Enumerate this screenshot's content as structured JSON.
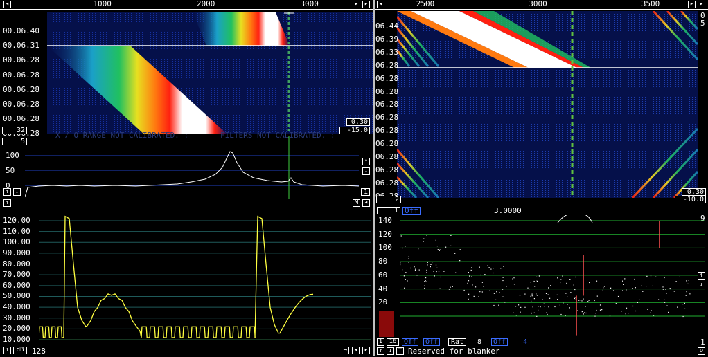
{
  "left_waterfall": {
    "freq_ticks": [
      {
        "freq": 1000,
        "label": "1000"
      },
      {
        "freq": 2000,
        "label": "2000"
      },
      {
        "freq": 3000,
        "label": "3000"
      }
    ],
    "freq_range": [
      0,
      3600
    ],
    "timestamps": [
      "00.06.40",
      "00.06.31",
      "00.06.28",
      "00.06.28",
      "00.06.28",
      "00.06.28",
      "00.06.28",
      "00.06.28"
    ],
    "box_left": "32",
    "box_right_top": "0.30",
    "box_right_bottom": "-15.0"
  },
  "left_spectrum": {
    "box_top_left": "5",
    "overlay_text_1": "X / Q RANGE NOT CALIBRATED. :",
    "overlay_text_2": "FILTERS NOT CALIBRATED. :",
    "yticks": [
      "100",
      "50",
      "0"
    ],
    "box_right": "1"
  },
  "left_filter": {
    "yticks": [
      "120.00",
      "110.00",
      "100.00",
      "90.000",
      "80.000",
      "70.000",
      "60.000",
      "50.000",
      "40.000",
      "30.000",
      "20.000",
      "10.000"
    ],
    "ylim": [
      10,
      120
    ],
    "m_label": "M",
    "db_label": "dB",
    "db_value": "128"
  },
  "right_waterfall": {
    "freq_ticks": [
      {
        "freq": 2500,
        "label": "2500"
      },
      {
        "freq": 3000,
        "label": "3000"
      },
      {
        "freq": 3500,
        "label": "3500"
      }
    ],
    "freq_range": [
      2270,
      3750
    ],
    "timestamps": [
      "06.44",
      "06.39",
      "06.33",
      "06.28",
      "06.28",
      "06.28",
      "06.28",
      "06.28",
      "06.28",
      "06.28",
      "06.28",
      "06.28",
      "06.28",
      "06.28"
    ],
    "side_digits": [
      "0",
      "5"
    ],
    "box_left": "2",
    "box_right_top": "0.30",
    "box_right_bottom": "-10.0"
  },
  "right_bottom": {
    "box_top": "1",
    "off_label": "Off",
    "center_value": "3.0000",
    "right_top_digit": "9",
    "yticks": [
      "140",
      "120",
      "100",
      "80",
      "60",
      "40",
      "20",
      "0"
    ],
    "ylim": [
      0,
      140
    ],
    "bottom_box_1": "1",
    "bottom_box_16": "16",
    "bottom_off_1": "Off",
    "bottom_off_2": "Off",
    "rat_label": "Rat",
    "rat_value": "8",
    "bottom_off_3": "Off",
    "bottom_value_4": "4",
    "right_bottom_digit": "1",
    "o_label": "o",
    "t_label": "T",
    "status": "Reserved for blanker"
  }
}
